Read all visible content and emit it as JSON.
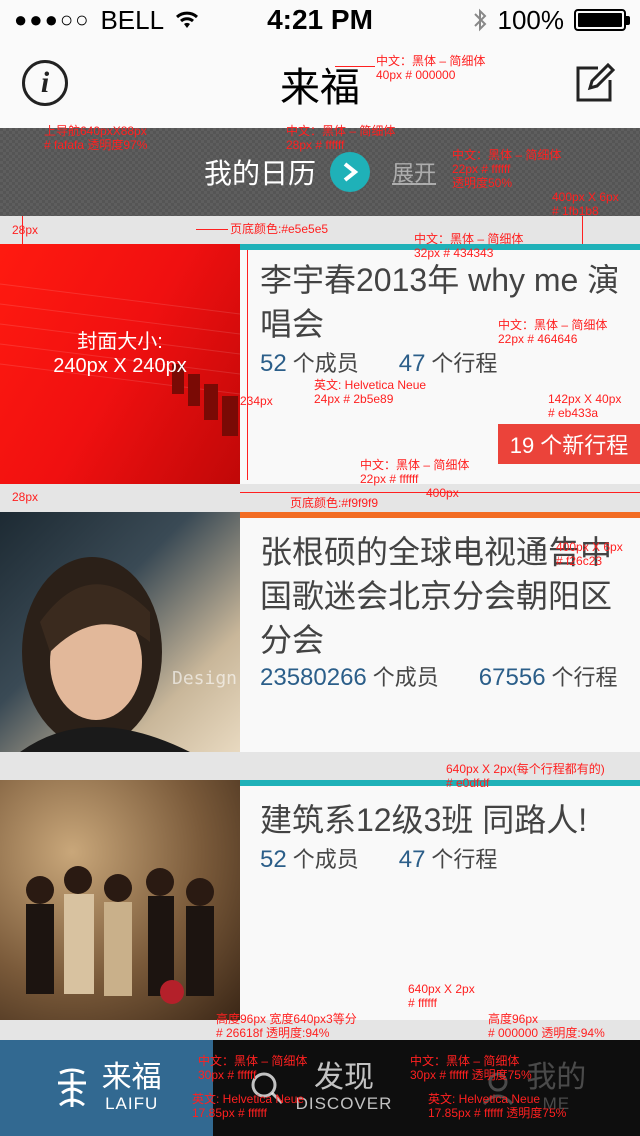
{
  "status": {
    "carrier": "BELL",
    "time": "4:21 PM",
    "battery": "100%"
  },
  "nav": {
    "title": "来福"
  },
  "calendar": {
    "title": "我的日历",
    "expand": "展开"
  },
  "cards": [
    {
      "title": "李宇春2013年 why me 演唱会",
      "members_num": "52",
      "members_label": "个成员",
      "trips_num": "47",
      "trips_label": "个行程",
      "badge": "19 个新行程",
      "cover_text": "封面大小:\n240px X 240px",
      "accent": "#1fb1b8"
    },
    {
      "title": "张根硕的全球电视通告中国歌迷会北京分会朝阳区分会",
      "members_num": "23580266",
      "members_label": "个成员",
      "trips_num": "67556",
      "trips_label": "个行程",
      "cover_watermark": "Design",
      "accent": "#f26c23"
    },
    {
      "title": "建筑系12级3班 同路人!",
      "members_num": "52",
      "members_label": "个成员",
      "trips_num": "47",
      "trips_label": "个行程",
      "accent": "#1fb1b8"
    }
  ],
  "tabs": [
    {
      "cn": "来福",
      "en": "LAIFU"
    },
    {
      "cn": "发现",
      "en": "DISCOVER"
    },
    {
      "cn": "我的",
      "en": "ME"
    }
  ],
  "annotations": {
    "a1": "中文：黑体 – 简细体\n40px   # 000000",
    "a2": "上导航640pxX88px\n# fafafa  透明度97%",
    "a3": "中文：黑体 – 简细体\n28px   # ffffff",
    "a4": "中文：黑体 – 简细体\n22px   # ffffff\n透明度50%",
    "a5": "400px X 6px\n# 1fb1b8",
    "a6": "28px",
    "a7": "页底颜色:#e5e5e5",
    "a8": "中文：黑体 – 简细体\n32px   # 434343",
    "a9": "中文：黑体 – 简细体\n22px   # 464646",
    "a10": "英文: Helvetica Neue\n24px   # 2b5e89",
    "a11": "142px X 40px\n# eb433a",
    "a12": "234px",
    "a13": "中文：黑体 – 简细体\n22px   # ffffff",
    "a14": "400px",
    "a15": "28px",
    "a16": "页底颜色:#f9f9f9",
    "a17": "400px X 6px\n# f26c23",
    "a18": "640px X 2px(每个行程都有的)\n# e0dfdf",
    "a19": "640px X 2px\n# ffffff",
    "a20": "高度96px  宽度640px3等分\n# 26618f   透明度:94%",
    "a21": "高度96px\n# 000000   透明度:94%",
    "a22": "中文：黑体 – 简细体\n30px   # ffffff",
    "a23": "英文: Helvetica Neue\n17.85px   # ffffff",
    "a24": "中文：黑体 – 简细体\n30px   # ffffff  透明度75%",
    "a25": "英文: Helvetica Neue\n17.85px   # ffffff  透明度75%"
  }
}
